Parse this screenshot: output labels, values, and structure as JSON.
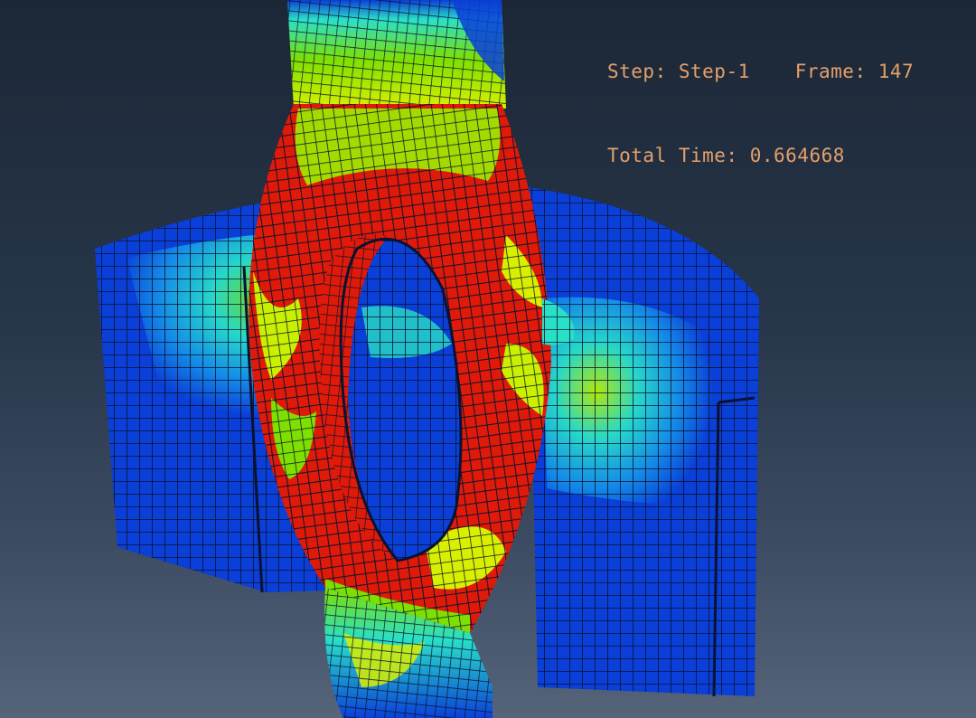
{
  "hud": {
    "step_label": "Step:",
    "step_value": "Step-1",
    "frame_label": "Frame:",
    "frame_value": "147",
    "time_label": "Total Time:",
    "time_value": "0.664668"
  },
  "colors": {
    "background_top": "#1c2736",
    "background_bottom": "#56647a",
    "contour_low": "#0a3fd8",
    "contour_mid": "#28e0c8",
    "contour_upper": "#7ee000",
    "contour_high": "#e01a08",
    "mesh_line": "#0b1230",
    "hud_text": "#e4a06a"
  }
}
